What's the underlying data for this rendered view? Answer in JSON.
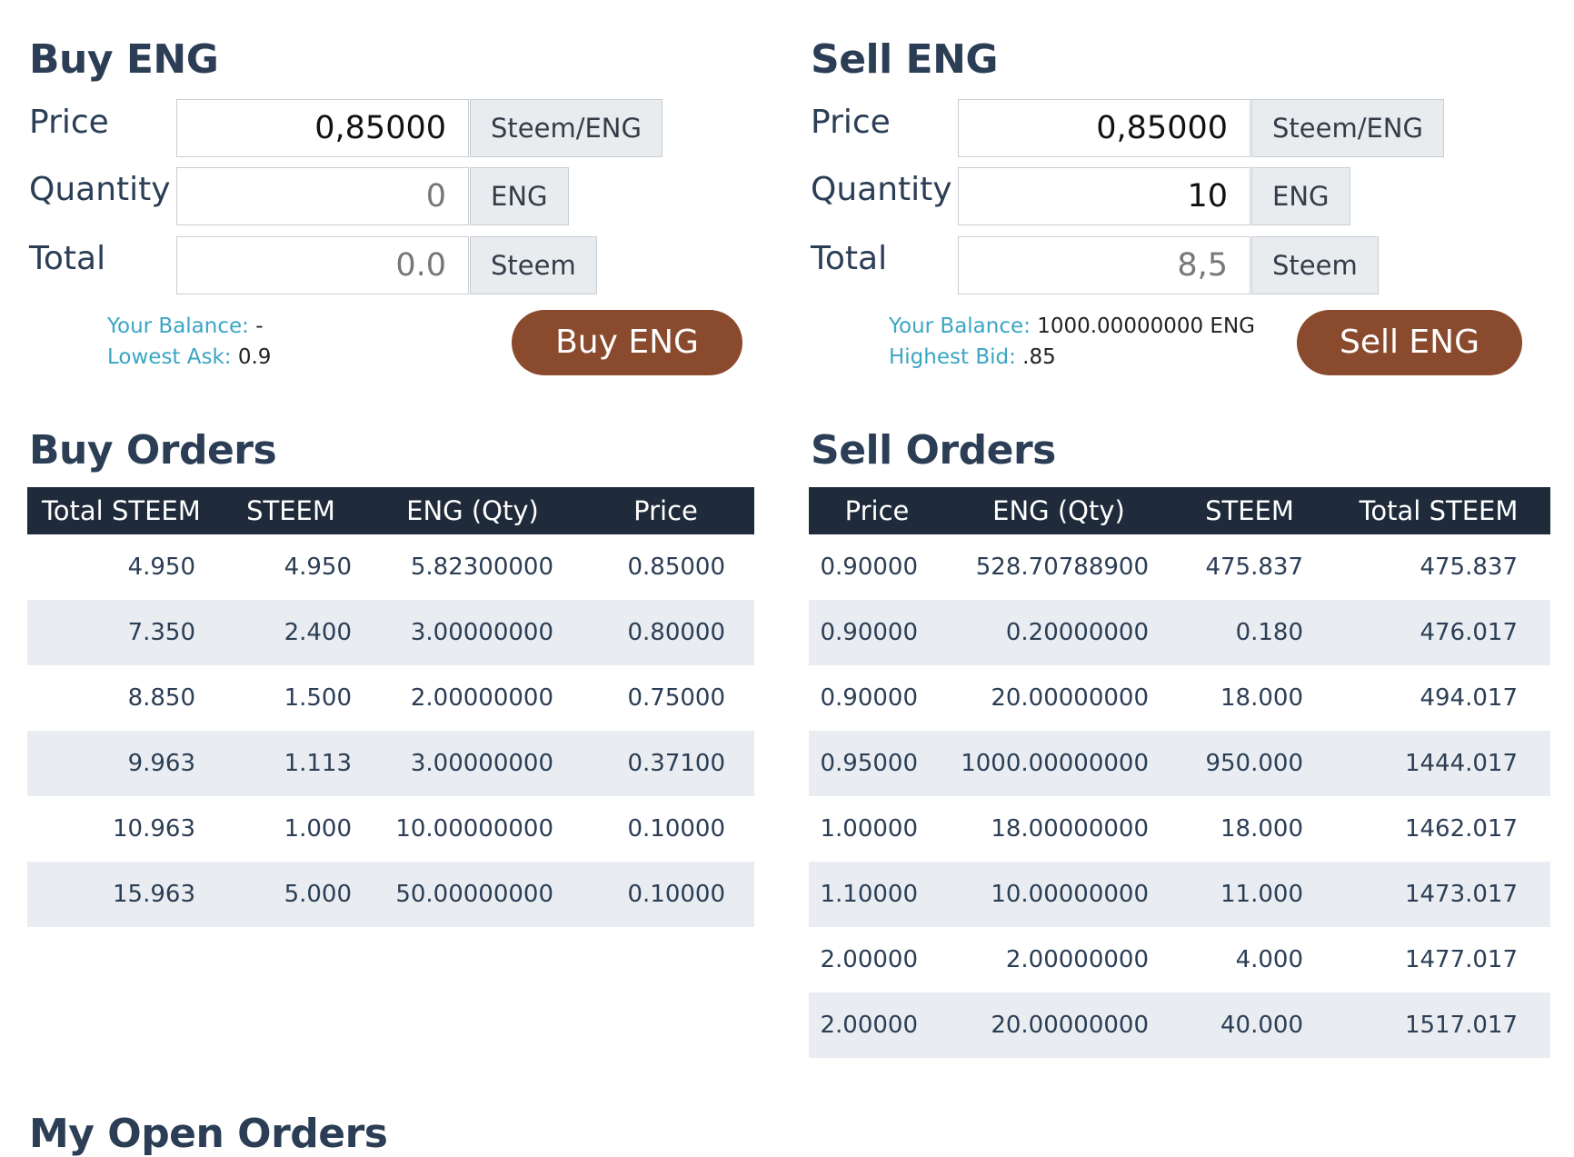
{
  "buy_form": {
    "title": "Buy ENG",
    "price_label": "Price",
    "price_value": "0,85000",
    "price_unit": "Steem/ENG",
    "quantity_label": "Quantity",
    "quantity_value": "0",
    "quantity_unit": "ENG",
    "total_label": "Total",
    "total_value": "0.0",
    "total_unit": "Steem",
    "balance_label": "Your Balance:",
    "balance_value": " -",
    "market_label": "Lowest Ask:",
    "market_value": " 0.9",
    "button_label": "Buy ENG"
  },
  "sell_form": {
    "title": "Sell ENG",
    "price_label": "Price",
    "price_value": "0,85000",
    "price_unit": "Steem/ENG",
    "quantity_label": "Quantity",
    "quantity_value": "10",
    "quantity_unit": "ENG",
    "total_label": "Total",
    "total_value": "8,5",
    "total_unit": "Steem",
    "balance_label": "Your Balance:",
    "balance_value": " 1000.00000000 ENG",
    "market_label": "Highest Bid:",
    "market_value": " .85",
    "button_label": "Sell ENG"
  },
  "buy_orders": {
    "title": "Buy Orders",
    "headers": [
      "Total STEEM",
      "STEEM",
      "ENG (Qty)",
      "Price"
    ],
    "rows": [
      [
        "4.950",
        "4.950",
        "5.82300000",
        "0.85000"
      ],
      [
        "7.350",
        "2.400",
        "3.00000000",
        "0.80000"
      ],
      [
        "8.850",
        "1.500",
        "2.00000000",
        "0.75000"
      ],
      [
        "9.963",
        "1.113",
        "3.00000000",
        "0.37100"
      ],
      [
        "10.963",
        "1.000",
        "10.00000000",
        "0.10000"
      ],
      [
        "15.963",
        "5.000",
        "50.00000000",
        "0.10000"
      ]
    ]
  },
  "sell_orders": {
    "title": "Sell Orders",
    "headers": [
      "Price",
      "ENG (Qty)",
      "STEEM",
      "Total STEEM"
    ],
    "rows": [
      [
        "0.90000",
        "528.70788900",
        "475.837",
        "475.837"
      ],
      [
        "0.90000",
        "0.20000000",
        "0.180",
        "476.017"
      ],
      [
        "0.90000",
        "20.00000000",
        "18.000",
        "494.017"
      ],
      [
        "0.95000",
        "1000.00000000",
        "950.000",
        "1444.017"
      ],
      [
        "1.00000",
        "18.00000000",
        "18.000",
        "1462.017"
      ],
      [
        "1.10000",
        "10.00000000",
        "11.000",
        "1473.017"
      ],
      [
        "2.00000",
        "2.00000000",
        "4.000",
        "1477.017"
      ],
      [
        "2.00000",
        "20.00000000",
        "40.000",
        "1517.017"
      ]
    ]
  },
  "my_open_orders": {
    "title": "My Open Orders"
  },
  "colors": {
    "heading": "#2b3e55",
    "info_label": "#3aa5c4",
    "action_button": "#8a4a2d",
    "table_header": "#1f2a3a",
    "row_stripe": "#e9edf1",
    "addon_bg": "#e9ecef"
  }
}
